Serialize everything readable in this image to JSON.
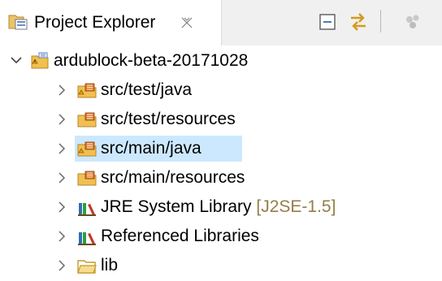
{
  "view": {
    "title": "Project Explorer",
    "close_icon": "close-icon",
    "toolbar": [
      {
        "name": "collapse-all-icon"
      },
      {
        "name": "link-with-editor-icon"
      },
      {
        "name": "view-menu-icon"
      }
    ]
  },
  "tree": {
    "project": {
      "label": "ardublock-beta-20171028",
      "icon": "java-project-icon",
      "expanded": true
    },
    "children": [
      {
        "label": "src/test/java",
        "icon": "source-folder-icon",
        "selected": false
      },
      {
        "label": "src/test/resources",
        "icon": "source-folder-icon",
        "selected": false
      },
      {
        "label": "src/main/java",
        "icon": "source-folder-icon",
        "selected": true
      },
      {
        "label": "src/main/resources",
        "icon": "source-folder-icon",
        "selected": false
      },
      {
        "label": "JRE System Library",
        "decoration": "[J2SE-1.5]",
        "icon": "library-icon",
        "selected": false
      },
      {
        "label": "Referenced Libraries",
        "icon": "library-icon",
        "selected": false
      },
      {
        "label": "lib",
        "icon": "folder-icon",
        "selected": false
      }
    ]
  },
  "colors": {
    "selection": "#cce8ff",
    "decoration": "#957d47",
    "folder": "#f0c050",
    "warning": "#e8a317"
  }
}
